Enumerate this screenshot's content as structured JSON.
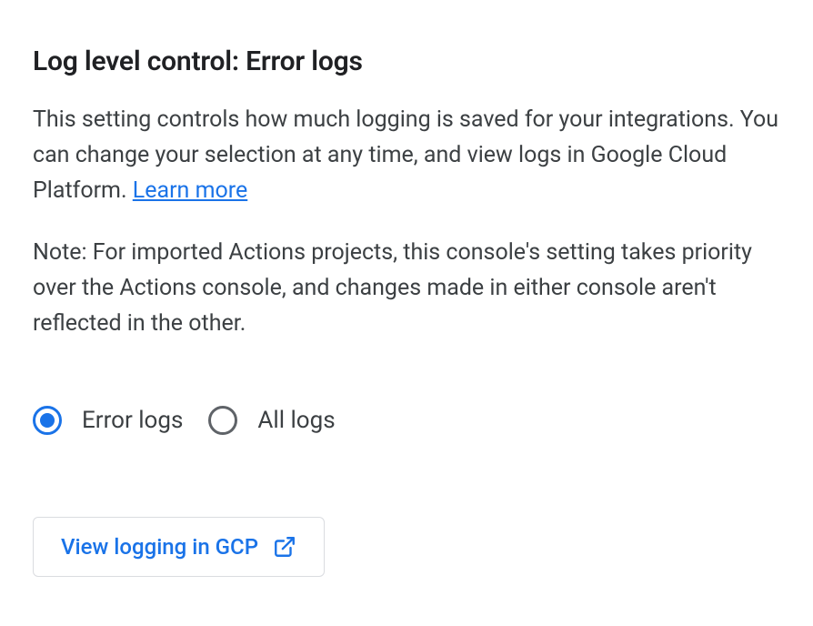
{
  "heading": "Log level control: Error logs",
  "description_text": "This setting controls how much logging is saved for your integrations. You can change your selection at any time, and view logs in Google Cloud Platform. ",
  "learn_more": "Learn more",
  "note": "Note: For imported Actions projects, this console's setting takes priority over the Actions console, and changes made in either console aren't reflected in the other.",
  "radio": {
    "options": [
      {
        "label": "Error logs",
        "selected": true
      },
      {
        "label": "All logs",
        "selected": false
      }
    ]
  },
  "button": {
    "label": "View logging in GCP"
  }
}
